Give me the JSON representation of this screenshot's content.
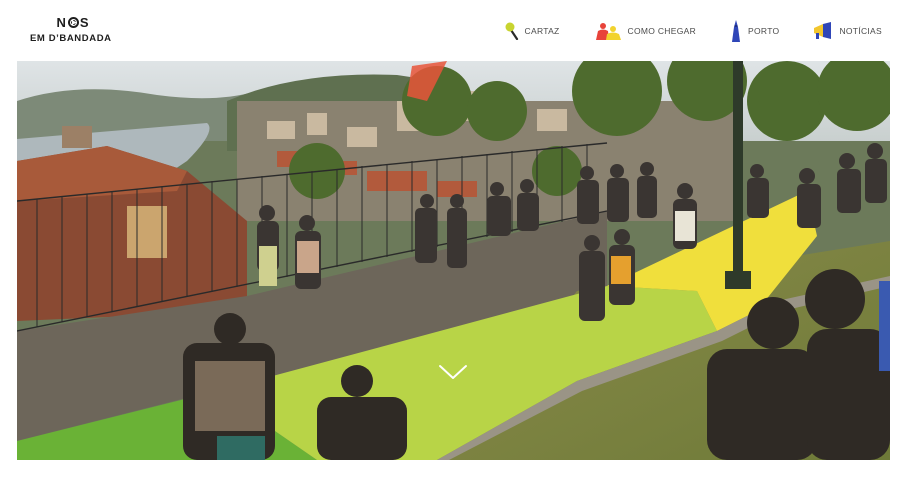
{
  "logo": {
    "line1_left": "N",
    "line1_right": "S",
    "line2": "EM D’BANDADA"
  },
  "nav": {
    "items": [
      {
        "label": "CARTAZ",
        "icon": "microphone-icon",
        "icon_color": "#c8d430"
      },
      {
        "label": "COMO CHEGAR",
        "icon": "people-icon",
        "icon_colors": [
          "#e8433a",
          "#f2d32e"
        ]
      },
      {
        "label": "PORTO",
        "icon": "tower-icon",
        "icon_color": "#2f46b8"
      },
      {
        "label": "NOTÍCIAS",
        "icon": "megaphone-icon",
        "icon_colors": [
          "#f2c62e",
          "#2f46b8"
        ]
      }
    ]
  },
  "hero": {
    "image": "photo of a crowd on a terrace overlooking Porto with a painted green and yellow path",
    "path_colors": [
      "#6ab236",
      "#b8d447",
      "#f0df3c"
    ],
    "scroll_icon": "chevron-down-icon"
  }
}
